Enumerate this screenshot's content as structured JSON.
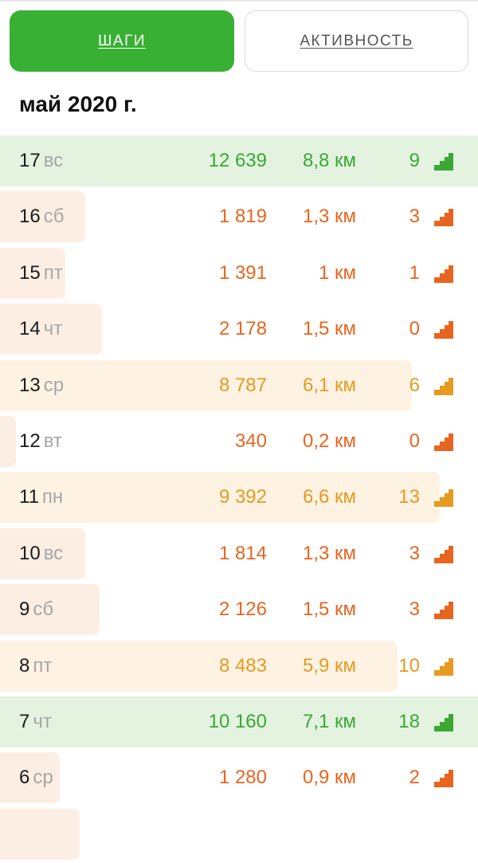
{
  "tabs": {
    "steps_label": "ШАГИ",
    "activity_label": "АКТИВНОСТЬ"
  },
  "month_title": "май 2020 г.",
  "colors": {
    "green": "#3aa833",
    "orange": "#e8651f",
    "amber": "#e69a20",
    "green_tab": "#38b034"
  },
  "rows": [
    {
      "day": "17",
      "weekday": "вс",
      "steps": "12 639",
      "distance": "8,8 км",
      "floors": "9",
      "status": "green"
    },
    {
      "day": "16",
      "weekday": "сб",
      "steps": "1 819",
      "distance": "1,3 км",
      "floors": "3",
      "status": "orange"
    },
    {
      "day": "15",
      "weekday": "пт",
      "steps": "1 391",
      "distance": "1 км",
      "floors": "1",
      "status": "orange"
    },
    {
      "day": "14",
      "weekday": "чт",
      "steps": "2 178",
      "distance": "1,5 км",
      "floors": "0",
      "status": "orange"
    },
    {
      "day": "13",
      "weekday": "ср",
      "steps": "8 787",
      "distance": "6,1 км",
      "floors": "6",
      "status": "amber"
    },
    {
      "day": "12",
      "weekday": "вт",
      "steps": "340",
      "distance": "0,2 км",
      "floors": "0",
      "status": "orange"
    },
    {
      "day": "11",
      "weekday": "пн",
      "steps": "9 392",
      "distance": "6,6 км",
      "floors": "13",
      "status": "amber"
    },
    {
      "day": "10",
      "weekday": "вс",
      "steps": "1 814",
      "distance": "1,3 км",
      "floors": "3",
      "status": "orange"
    },
    {
      "day": "9",
      "weekday": "сб",
      "steps": "2 126",
      "distance": "1,5 км",
      "floors": "3",
      "status": "orange"
    },
    {
      "day": "8",
      "weekday": "пт",
      "steps": "8 483",
      "distance": "5,9 км",
      "floors": "10",
      "status": "amber"
    },
    {
      "day": "7",
      "weekday": "чт",
      "steps": "10 160",
      "distance": "7,1 км",
      "floors": "18",
      "status": "green"
    },
    {
      "day": "6",
      "weekday": "ср",
      "steps": "1 280",
      "distance": "0,9 км",
      "floors": "2",
      "status": "orange"
    },
    {
      "day": "",
      "weekday": "",
      "steps": "",
      "distance": "",
      "floors": "",
      "status": "orange"
    }
  ]
}
